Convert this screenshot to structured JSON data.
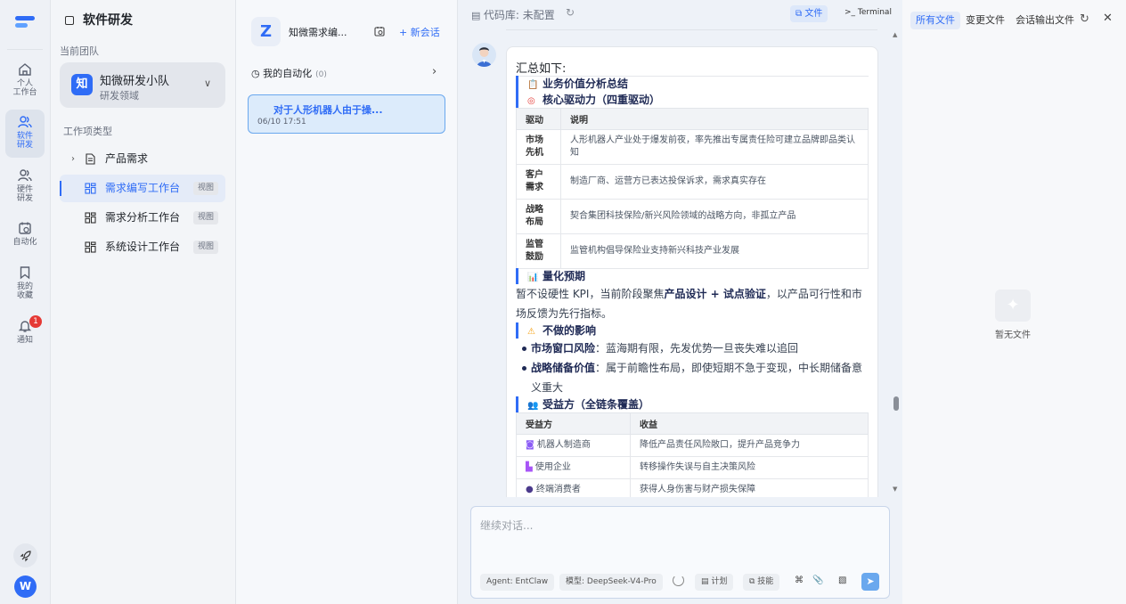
{
  "rail": {
    "items": [
      {
        "label": "个人工作台",
        "line1": "个人",
        "line2": "工作台",
        "icon": "home-icon"
      },
      {
        "label": "软件研发",
        "line1": "软件",
        "line2": "研发",
        "icon": "users-icon"
      },
      {
        "label": "硬件研发",
        "line1": "硬件",
        "line2": "研发",
        "icon": "users-icon"
      },
      {
        "label": "自动化",
        "line1": "自动化",
        "line2": "",
        "icon": "calendar-clock-icon"
      },
      {
        "label": "我的收藏",
        "line1": "我的",
        "line2": "收藏",
        "icon": "bookmark-icon"
      },
      {
        "label": "通知",
        "line1": "通知",
        "line2": "",
        "icon": "bell-icon"
      }
    ],
    "notification_count": "1",
    "avatar_letter": "W"
  },
  "sidebar": {
    "title": "软件研发",
    "team_label": "当前团队",
    "team": {
      "logo": "知",
      "name": "知微研发小队",
      "subtitle": "研发领域"
    },
    "section_label": "工作项类型",
    "items": [
      {
        "label": "产品需求",
        "tag": ""
      },
      {
        "label": "需求编写工作台",
        "tag": "视图"
      },
      {
        "label": "需求分析工作台",
        "tag": "视图"
      },
      {
        "label": "系统设计工作台",
        "tag": "视图"
      }
    ]
  },
  "conversations": {
    "title": "知微需求编...",
    "new_label": "+ 新会话",
    "auto_label": "我的自动化",
    "auto_count": "(0)",
    "active": {
      "title": "对于人形机器人由于操...",
      "date": "06/10 17:51"
    }
  },
  "chat": {
    "repo_label": "代码库: 未配置",
    "file_btn": "文件",
    "terminal_btn": "Terminal",
    "message": {
      "intro": "汇总如下:",
      "h_value": "业务价值分析总结",
      "h_drive": "核心驱动力（四重驱动）",
      "drive_headers": [
        "驱动",
        "说明"
      ],
      "drive_rows": [
        {
          "k": "市场先机",
          "v": "人形机器人产业处于爆发前夜，率先推出专属责任险可建立品牌即品类认知"
        },
        {
          "k": "客户需求",
          "v": "制造厂商、运营方已表达投保诉求，需求真实存在"
        },
        {
          "k": "战略布局",
          "v": "契合集团科技保险/新兴风险领域的战略方向，非孤立产品"
        },
        {
          "k": "监管鼓励",
          "v": "监管机构倡导保险业支持新兴科技产业发展"
        }
      ],
      "h_quant": "量化预期",
      "quant_pre": "暂不设硬性 KPI，当前阶段聚焦",
      "quant_bold": "产品设计 + 试点验证",
      "quant_post": "，以产品可行性和市场反馈为先行指标。",
      "h_impact": "不做的影响",
      "impacts": [
        {
          "k": "市场窗口风险",
          "v": "：蓝海期有限，先发优势一旦丧失难以追回"
        },
        {
          "k": "战略储备价值",
          "v": "：属于前瞻性布局，即使短期不急于变现，中长期储备意义重大"
        }
      ],
      "h_benef": "受益方（全链条覆盖）",
      "benef_headers": [
        "受益方",
        "收益"
      ],
      "benef_rows": [
        {
          "k": "机器人制造商",
          "v": "降低产品责任风险敞口，提升产品竞争力",
          "icon": "robot-icon"
        },
        {
          "k": "使用企业",
          "v": "转移操作失误与自主决策风险",
          "icon": "factory-icon"
        },
        {
          "k": "终端消费者",
          "v": "获得人身伤害与财产损失保障",
          "icon": "person-icon"
        }
      ]
    },
    "input_placeholder": "继续对话...",
    "agent_chip": "Agent: EntClaw",
    "model_chip": "模型: DeepSeek-V4-Pro",
    "plan_label": "计划",
    "skill_label": "技能"
  },
  "files": {
    "tabs": [
      "所有文件",
      "变更文件",
      "会话输出文件"
    ],
    "empty_text": "暂无文件"
  },
  "colors": {
    "accent": "#2f6cf6",
    "heading": "#1f2a55",
    "badge": "#e53935"
  }
}
